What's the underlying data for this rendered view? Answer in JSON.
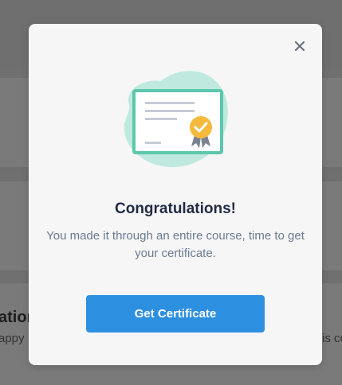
{
  "background": {
    "heading_fragment": "ation",
    "subtext_fragment_left": "appy",
    "subtext_fragment_right": "is co"
  },
  "modal": {
    "close_icon": "close-icon",
    "illustration_icon": "certificate-icon",
    "title": "Congratulations!",
    "message": "You made it through an entire course, time to get your certificate.",
    "cta_label": "Get Certificate"
  },
  "colors": {
    "accent": "#2d8fe0",
    "title": "#1f2a44",
    "body_text": "#6b7a90",
    "illustration_teal": "#5cc7ad",
    "illustration_blob": "#bfe9df",
    "badge": "#f5b93d",
    "ribbon": "#7a8290"
  }
}
